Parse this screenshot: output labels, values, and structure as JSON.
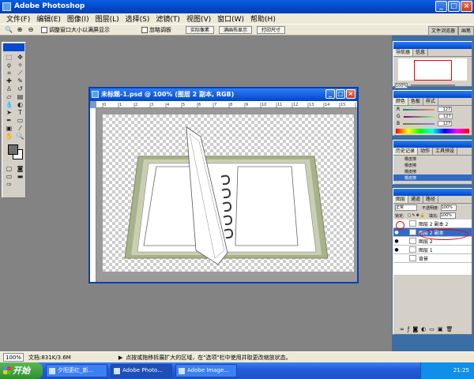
{
  "app": {
    "title": "Adobe Photoshop"
  },
  "menu": [
    "文件(F)",
    "编辑(E)",
    "图像(I)",
    "图层(L)",
    "选择(S)",
    "滤镜(T)",
    "视图(V)",
    "窗口(W)",
    "帮助(H)"
  ],
  "options": {
    "resize_label": "调整窗口大小以满屏显示",
    "ignore_palettes_label": "忽略调板",
    "btn_actual": "实际像素",
    "btn_fit": "满画布显示",
    "btn_print": "打印尺寸",
    "tab_browser": "文件浏览器",
    "tab_brush": "画笔"
  },
  "document": {
    "title": "未标题-1.psd @ 100% (图层 2 副本, RGB)",
    "ruler_marks": [
      "0",
      "1",
      "2",
      "3",
      "4",
      "5",
      "6",
      "7",
      "8",
      "9",
      "10",
      "11",
      "12",
      "13",
      "14",
      "15",
      "16"
    ]
  },
  "navigator": {
    "tabs": [
      "导航器",
      "信息"
    ],
    "zoom": "100%"
  },
  "color_panel": {
    "tabs": [
      "颜色",
      "色板",
      "样式"
    ],
    "rows": [
      {
        "label": "R",
        "value": "127"
      },
      {
        "label": "G",
        "value": "127"
      },
      {
        "label": "B",
        "value": "127"
      }
    ]
  },
  "history": {
    "tabs": [
      "历史记录",
      "动作",
      "工具预设"
    ],
    "items": [
      "橡皮擦",
      "橡皮擦",
      "橡皮擦",
      "橡皮擦"
    ]
  },
  "layers": {
    "tabs": [
      "图层",
      "通道",
      "路径"
    ],
    "blend_mode": "正常",
    "opacity_label": "不透明度:",
    "opacity": "100%",
    "lock_label": "锁定:",
    "fill_label": "填充:",
    "fill": "100%",
    "items": [
      {
        "name": "图层 2 副本 2",
        "eye": "",
        "selected": false
      },
      {
        "name": "图层 2 副本",
        "eye": "●",
        "selected": true
      },
      {
        "name": "图层 2",
        "eye": "●",
        "selected": false
      },
      {
        "name": "图层 1",
        "eye": "●",
        "selected": false
      },
      {
        "name": "背景",
        "eye": "",
        "selected": false
      }
    ]
  },
  "status": {
    "zoom": "100%",
    "doc": "文档:831K/3.6M",
    "hint": "点按或拖移拆展扩大的区域，在\"选项\"栏中使用并取更改缩放状态。"
  },
  "taskbar": {
    "start": "开始",
    "tasks": [
      "夕阳更红_新...",
      "Adobe Photo...",
      "Adobe Image..."
    ],
    "clock": "21:25"
  },
  "colors": {
    "title_blue": "#0046c8",
    "workspace_gray": "#838383",
    "selection_blue": "#316ac5",
    "annotation_red": "#e00000"
  }
}
